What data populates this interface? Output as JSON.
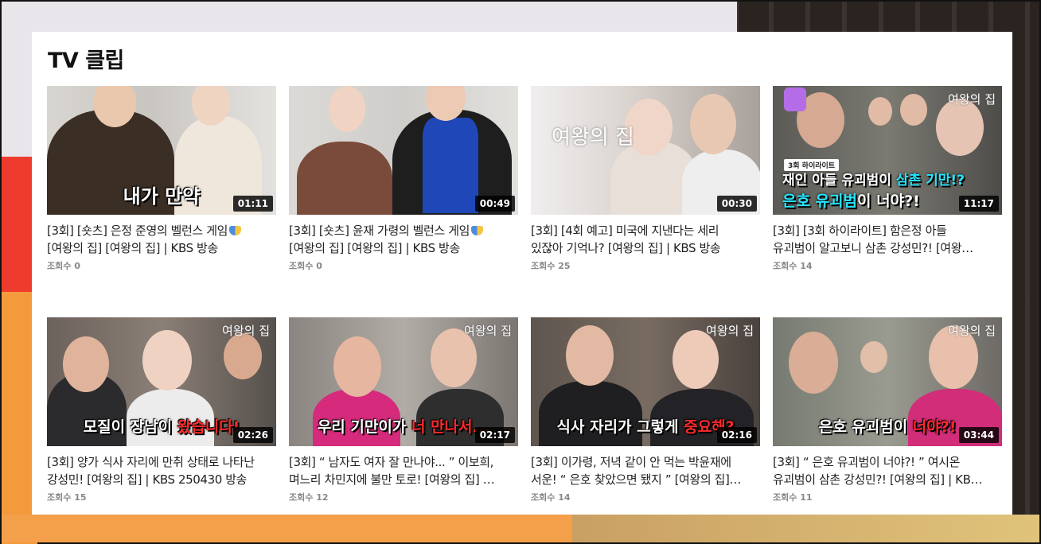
{
  "section": {
    "title": "TV 클립"
  },
  "clips": [
    {
      "title_line1": "[3회] [숏츠] 은정 준영의 벨런스 게임",
      "title_line2": "[여왕의 집] [여왕의 집] | KBS 방송",
      "views": "조회수 0",
      "duration": "01:11",
      "thumb_caption": "내가 만약",
      "has_icon": true
    },
    {
      "title_line1": "[3회] [숏츠] 윤재 가령의 벨런스 게임",
      "title_line2": "[여왕의 집] [여왕의 집] | KBS 방송",
      "views": "조회수 0",
      "duration": "00:49",
      "thumb_caption": "",
      "has_icon": true
    },
    {
      "title_line1": "[3회] [4회 예고] 미국에 지낸다는 세리",
      "title_line2": "있잖아 기억나? [여왕의 집] | KBS 방송",
      "views": "조회수 25",
      "duration": "00:30",
      "thumb_caption": "",
      "logo": "여왕의 집"
    },
    {
      "title_line1": "[3회] [3회 하이라이트] 함은정 아들",
      "title_line2": "유괴범이 알고보니 삼촌 강성민?! [여왕…",
      "views": "조회수 14",
      "duration": "11:17",
      "tag": "3회 하이라이트",
      "thumb_line1_a": "재인 아들 유괴범이 ",
      "thumb_line1_b": "삼촌 기만!?",
      "thumb_line2_a": "은호 유괴범",
      "thumb_line2_b": "이 너야?!",
      "logo": "여왕의 집"
    },
    {
      "title_line1": "[3회] 양가 식사 자리에 만취 상태로 나타난",
      "title_line2": "강성민! [여왕의 집] | KBS 250430 방송",
      "views": "조회수 15",
      "duration": "02:26",
      "thumb_caption_a": "모질이 장남이 ",
      "thumb_caption_b": "왔습니다!",
      "logo": "여왕의 집"
    },
    {
      "title_line1": "[3회] “ 남자도 여자 잘 만나야... ” 이보희,",
      "title_line2": "며느리 차민지에 불만 토로! [여왕의 집] …",
      "views": "조회수 12",
      "duration": "02:17",
      "thumb_caption_a": "우리 기만이가 ",
      "thumb_caption_b": "너 만나서...",
      "logo": "여왕의 집"
    },
    {
      "title_line1": "[3회] 이가령, 저녁 같이 안 먹는 박윤재에",
      "title_line2": "서운! “ 은호 찾았으면 됐지 ” [여왕의 집]…",
      "views": "조회수 14",
      "duration": "02:16",
      "thumb_caption_a": "식사 자리가 그렇게 ",
      "thumb_caption_b": "중요해?",
      "logo": "여왕의 집"
    },
    {
      "title_line1": "[3회] “ 은호 유괴범이 너야?! ” 여시온",
      "title_line2": "유괴범이 삼촌 강성민?! [여왕의 집] | KB…",
      "views": "조회수 11",
      "duration": "03:44",
      "thumb_caption_a": "은호 유괴범이 ",
      "thumb_caption_b": "너야?!",
      "logo": "여왕의 집"
    }
  ]
}
